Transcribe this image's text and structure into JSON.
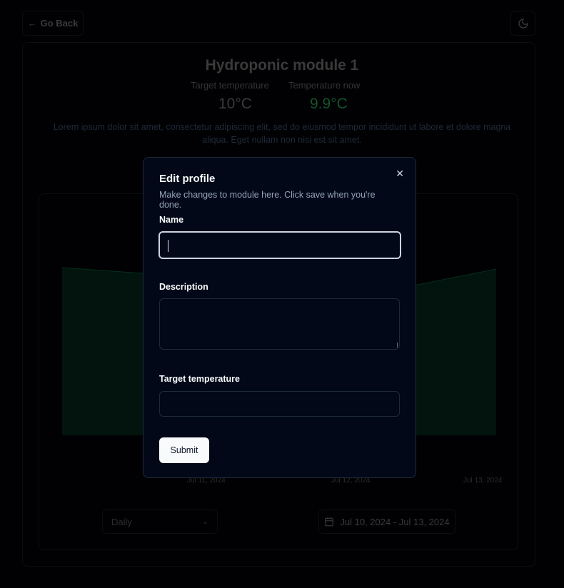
{
  "header": {
    "back_label": "Go Back",
    "theme_icon": "moon-icon"
  },
  "module": {
    "title": "Hydroponic module 1",
    "target_label": "Target temperature",
    "target_value": "10°C",
    "now_label": "Temperature now",
    "now_value": "9.9°C",
    "now_color": "#14532d",
    "description": "Lorem ipsum dolor sit amet, consectetur adipiscing elit, sed do eiusmod tempor incididunt ut labore et dolore magna aliqua. Eget nullam non nisi est sit amet."
  },
  "chart": {
    "x_ticks": [
      "Jul 11, 2024",
      "Jul 12, 2024",
      "Jul 13, 2024"
    ],
    "area_color": "#052e1c"
  },
  "controls": {
    "interval": "Daily",
    "date_range": "Jul 10, 2024 - Jul 13, 2024"
  },
  "dialog": {
    "title": "Edit profile",
    "subtitle": "Make changes to module here. Click save when you're done.",
    "name_label": "Name",
    "name_value": "",
    "description_label": "Description",
    "description_value": "",
    "target_label": "Target temperature",
    "target_value": "",
    "submit_label": "Submit"
  }
}
